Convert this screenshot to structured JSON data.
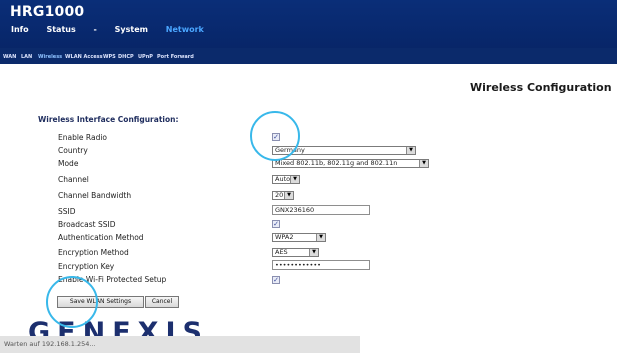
{
  "app": {
    "model": "HRG1000"
  },
  "main_nav": [
    {
      "label": "Info",
      "active": false
    },
    {
      "label": "Status",
      "active": false
    },
    {
      "label": "-",
      "active": false
    },
    {
      "label": "System",
      "active": false
    },
    {
      "label": "Network",
      "active": true
    }
  ],
  "sub_nav": [
    {
      "label": "WAN",
      "active": false
    },
    {
      "label": "LAN",
      "active": false
    },
    {
      "label": "Wireless",
      "active": true
    },
    {
      "label": "WLAN Access",
      "active": false
    },
    {
      "label": "WPS",
      "active": false
    },
    {
      "label": "DHCP",
      "active": false
    },
    {
      "label": "UPnP",
      "active": false
    },
    {
      "label": "Port Forward",
      "active": false
    }
  ],
  "page": {
    "heading": "Wireless Configuration",
    "section_title": "Wireless Interface Configuration:"
  },
  "form": {
    "enable_radio": {
      "label": "Enable Radio",
      "checked": true,
      "mark": "✓"
    },
    "country": {
      "label": "Country",
      "value": "Germany"
    },
    "mode": {
      "label": "Mode",
      "value": "Mixed 802.11b, 802.11g and 802.11n"
    },
    "channel": {
      "label": "Channel",
      "value": "Auto"
    },
    "channel_bandwidth": {
      "label": "Channel Bandwidth",
      "value": "20"
    },
    "ssid": {
      "label": "SSID",
      "value": "GNX236160"
    },
    "broadcast_ssid": {
      "label": "Broadcast SSID",
      "checked": true,
      "mark": "✓"
    },
    "auth_method": {
      "label": "Authentication Method",
      "value": "WPA2"
    },
    "enc_method": {
      "label": "Encryption Method",
      "value": "AES"
    },
    "enc_key": {
      "label": "Encryption Key",
      "value": "••••••••••••"
    },
    "wps": {
      "label": "Enable Wi-Fi Protected Setup",
      "checked": true,
      "mark": "✓"
    }
  },
  "buttons": {
    "save": "Save WLAN Settings",
    "cancel": "Cancel"
  },
  "logo": {
    "text": "GENEXIS"
  },
  "statusbar": {
    "text": "Warten auf 192.168.1.254..."
  },
  "icons": {
    "dropdown_arrow": "▼"
  },
  "colors": {
    "header_bg": "#0a2e78",
    "active_nav": "#4aa6ff",
    "highlight_circle": "#38b8ea"
  }
}
